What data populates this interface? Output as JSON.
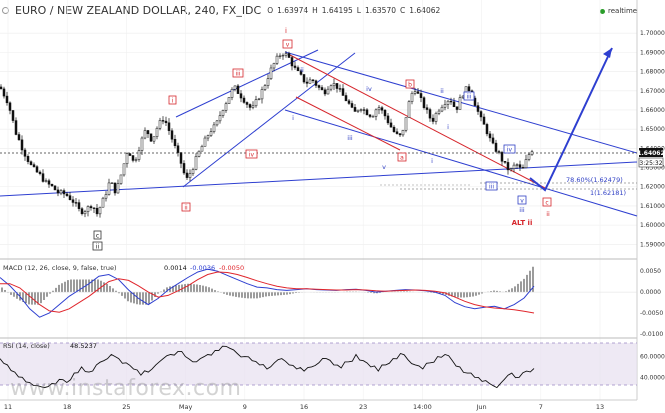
{
  "header": {
    "title": "EURO / NEW ZEALAND DOLLAR, 240, FX_IDC",
    "open_label": "O",
    "open": "1.63974",
    "high_label": "H",
    "high": "1.64195",
    "low_label": "L",
    "low": "1.63570",
    "close_label": "C",
    "close": "1.64062"
  },
  "realtime_label": "realtime",
  "watermark": "www.instaforex.com",
  "colors": {
    "wave_red": "#d6262c",
    "wave_blue": "#2f3fc4",
    "trend_blue": "#2e3fd0",
    "candle": "#111111",
    "grid": "#ececec"
  },
  "chart_data": [
    {
      "type": "candlestick",
      "x_tick_labels": [
        "11",
        "18",
        "25",
        "May",
        "9",
        "16",
        "23",
        "14:00",
        "Jun",
        "7",
        "13"
      ],
      "y_tick_labels": [
        "1.70000",
        "1.69000",
        "1.68000",
        "1.67000",
        "1.66000",
        "1.65000",
        "1.64000",
        "1.63000",
        "1.62000",
        "1.61000",
        "1.60000",
        "1.59000"
      ],
      "ylim": [
        1.586,
        1.71
      ],
      "price_badge": "1.64062",
      "time_badge": "3:25:32",
      "close_path": [
        [
          0,
          1.672
        ],
        [
          8,
          1.664
        ],
        [
          16,
          1.648
        ],
        [
          24,
          1.638
        ],
        [
          32,
          1.63
        ],
        [
          40,
          1.626
        ],
        [
          46,
          1.622
        ],
        [
          52,
          1.62
        ],
        [
          58,
          1.617
        ],
        [
          66,
          1.616
        ],
        [
          74,
          1.612
        ],
        [
          80,
          1.607
        ],
        [
          86,
          1.608
        ],
        [
          92,
          1.611
        ],
        [
          97,
          1.606
        ],
        [
          104,
          1.614
        ],
        [
          110,
          1.623
        ],
        [
          116,
          1.617
        ],
        [
          122,
          1.628
        ],
        [
          128,
          1.64
        ],
        [
          134,
          1.632
        ],
        [
          140,
          1.642
        ],
        [
          146,
          1.65
        ],
        [
          152,
          1.644
        ],
        [
          158,
          1.652
        ],
        [
          164,
          1.656
        ],
        [
          170,
          1.648
        ],
        [
          176,
          1.639
        ],
        [
          182,
          1.631
        ],
        [
          186,
          1.623
        ],
        [
          192,
          1.629
        ],
        [
          198,
          1.637
        ],
        [
          204,
          1.643
        ],
        [
          210,
          1.649
        ],
        [
          216,
          1.652
        ],
        [
          222,
          1.66
        ],
        [
          228,
          1.666
        ],
        [
          234,
          1.672
        ],
        [
          240,
          1.668
        ],
        [
          246,
          1.664
        ],
        [
          252,
          1.66
        ],
        [
          258,
          1.666
        ],
        [
          264,
          1.672
        ],
        [
          270,
          1.68
        ],
        [
          276,
          1.686
        ],
        [
          282,
          1.69
        ],
        [
          288,
          1.688
        ],
        [
          294,
          1.682
        ],
        [
          300,
          1.678
        ],
        [
          306,
          1.674
        ],
        [
          312,
          1.676
        ],
        [
          318,
          1.672
        ],
        [
          324,
          1.669
        ],
        [
          330,
          1.674
        ],
        [
          336,
          1.673
        ],
        [
          342,
          1.668
        ],
        [
          348,
          1.664
        ],
        [
          354,
          1.658
        ],
        [
          360,
          1.662
        ],
        [
          366,
          1.659
        ],
        [
          372,
          1.657
        ],
        [
          378,
          1.662
        ],
        [
          384,
          1.658
        ],
        [
          390,
          1.652
        ],
        [
          396,
          1.647
        ],
        [
          402,
          1.646
        ],
        [
          408,
          1.662
        ],
        [
          414,
          1.672
        ],
        [
          420,
          1.666
        ],
        [
          426,
          1.66
        ],
        [
          432,
          1.654
        ],
        [
          438,
          1.66
        ],
        [
          444,
          1.664
        ],
        [
          450,
          1.666
        ],
        [
          456,
          1.66
        ],
        [
          462,
          1.668
        ],
        [
          468,
          1.672
        ],
        [
          474,
          1.665
        ],
        [
          480,
          1.656
        ],
        [
          486,
          1.65
        ],
        [
          492,
          1.642
        ],
        [
          498,
          1.638
        ],
        [
          504,
          1.632
        ],
        [
          510,
          1.628
        ],
        [
          516,
          1.632
        ],
        [
          522,
          1.628
        ],
        [
          528,
          1.636
        ],
        [
          534,
          1.641
        ]
      ]
    },
    {
      "type": "line",
      "title": "MACD (12, 26, close, 9, false, true)",
      "values_text": [
        "0.0014",
        "-0.0036",
        "-0.0050"
      ],
      "y_tick_labels": [
        "0.0050",
        "0.0000",
        "-0.0050",
        "-0.0100"
      ],
      "ylim": [
        -0.0105,
        0.0072
      ],
      "series": [
        {
          "role": "macd",
          "values": [
            0.0035,
            0.0015,
            -0.001,
            -0.004,
            -0.006,
            -0.005,
            -0.003,
            -0.001,
            0.0005,
            0.002,
            0.0038,
            0.0042,
            0.003,
            0.0005,
            -0.0015,
            -0.003,
            -0.0015,
            0.0005,
            0.002,
            0.0035,
            0.0048,
            0.0055,
            0.005,
            0.004,
            0.003,
            0.002,
            0.0012,
            0.001,
            0.0006,
            0.0004,
            0.0006,
            0.0008,
            0.0006,
            0.0005,
            0.0004,
            0.0006,
            0.0007,
            0.0004,
            0.0,
            0.0002,
            0.0004,
            0.0006,
            0.0005,
            0.0003,
            0.0,
            -0.0008,
            -0.0025,
            -0.0035,
            -0.004,
            -0.0036,
            -0.0034,
            -0.004,
            -0.003,
            -0.0014,
            0.0014
          ]
        },
        {
          "role": "signal",
          "values": [
            0.002,
            0.002,
            0.001,
            -0.001,
            -0.003,
            -0.0045,
            -0.0048,
            -0.004,
            -0.0025,
            -0.001,
            0.0008,
            0.0025,
            0.0032,
            0.0028,
            0.0015,
            0.0,
            -0.0012,
            -0.0008,
            0.0003,
            0.0015,
            0.003,
            0.0042,
            0.0048,
            0.0047,
            0.0042,
            0.0035,
            0.0027,
            0.002,
            0.0014,
            0.001,
            0.0008,
            0.0008,
            0.0007,
            0.0006,
            0.0005,
            0.0005,
            0.0006,
            0.0005,
            0.0003,
            0.0002,
            0.0003,
            0.0004,
            0.0005,
            0.0004,
            0.0002,
            -0.0002,
            -0.0012,
            -0.0022,
            -0.003,
            -0.0035,
            -0.0038,
            -0.004,
            -0.0042,
            -0.0046,
            -0.005
          ]
        }
      ]
    },
    {
      "type": "line",
      "title": "RSI (14, close)",
      "values_text": [
        "48.5237"
      ],
      "y_tick_labels": [
        "60.0000",
        "40.0000"
      ],
      "ylim": [
        20,
        76
      ],
      "bands": [
        70,
        30
      ],
      "series": [
        {
          "role": "rsi",
          "values": [
            58,
            52,
            45,
            40,
            35,
            32,
            30,
            34,
            38,
            35,
            44,
            50,
            45,
            52,
            56,
            62,
            58,
            54,
            48,
            42,
            45,
            52,
            58,
            62,
            65,
            60,
            55,
            58,
            62,
            66,
            70,
            68,
            63,
            60,
            56,
            52,
            48,
            54,
            58,
            52,
            48,
            46,
            50,
            54,
            58,
            52,
            49,
            55,
            62,
            56,
            50,
            46,
            52,
            58,
            63,
            57,
            52,
            48,
            54,
            60,
            62,
            56,
            50,
            44,
            40,
            36,
            34,
            30,
            38,
            44,
            40,
            46,
            48.5
          ]
        }
      ]
    }
  ],
  "annotations": {
    "wave_i": "i",
    "wave_ii": "ii",
    "wave_iii": "iii",
    "wave_iv": "iv",
    "wave_v": "v",
    "wave_a": "a",
    "wave_b": "b",
    "wave_c": "c",
    "alt_ii": "ALT ii",
    "fib_label": "78.60%(1.62479)",
    "fib_level_label": "1(1.62181)"
  }
}
